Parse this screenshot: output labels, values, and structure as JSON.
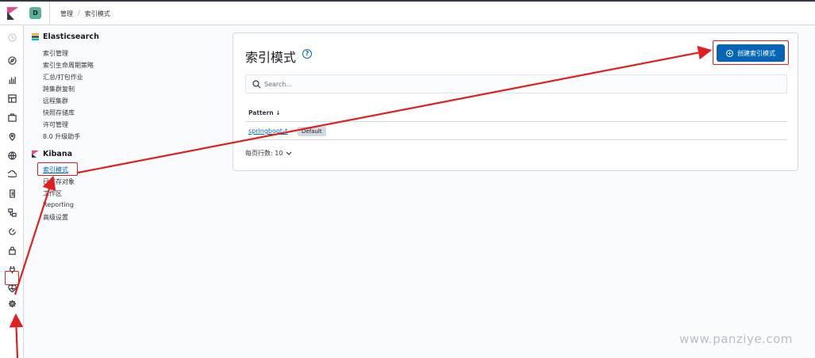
{
  "header": {
    "space_initial": "D",
    "breadcrumb": [
      "管理",
      "索引模式"
    ]
  },
  "sidebar": {
    "groups": [
      {
        "title": "Elasticsearch",
        "items": [
          "索引管理",
          "索引生命周期策略",
          "汇总/打包作业",
          "跨集群复制",
          "远程集群",
          "快照存储库",
          "许可管理",
          "8.0 升级助手"
        ]
      },
      {
        "title": "Kibana",
        "items": [
          "索引模式",
          "已保存对象",
          "工作区",
          "Reporting",
          "高级设置"
        ]
      }
    ],
    "active_item": "索引模式"
  },
  "main": {
    "title": "索引模式",
    "create_button": "创建索引模式",
    "search_placeholder": "Search...",
    "table": {
      "column_header": "Pattern ↓",
      "rows": [
        {
          "pattern": "springboot-*",
          "badge": "Default"
        }
      ]
    },
    "rows_per_page": "每页行数: 10"
  },
  "watermark": "www.panziye.com",
  "colors": {
    "primary": "#0765b5",
    "link": "#006bb8",
    "annotation": "#e02020",
    "space_badge": "#54b399"
  },
  "icons": {
    "rail": [
      "recent-icon",
      "discover-icon",
      "visualize-icon",
      "dashboard-icon",
      "canvas-icon",
      "maps-icon",
      "ml-icon",
      "infrastructure-icon",
      "logs-icon",
      "apm-icon",
      "uptime-icon",
      "siem-icon",
      "dev-tools-icon",
      "monitoring-icon",
      "management-gear-icon"
    ]
  }
}
